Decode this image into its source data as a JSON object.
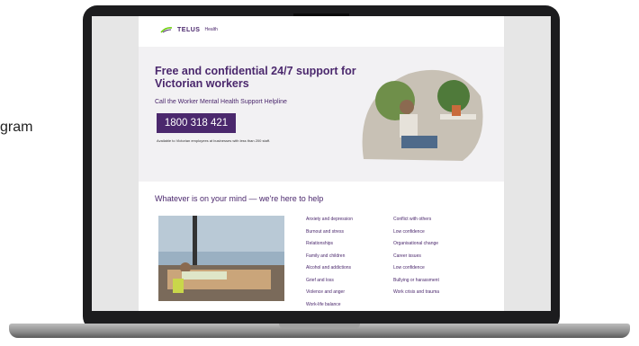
{
  "side_text": "gram",
  "brand": {
    "name": "TELUS",
    "sub": "Health"
  },
  "hero": {
    "title": "Free and confidential 24/7 support for Victorian workers",
    "subtitle": "Call the Worker Mental Health Support Helpline",
    "phone": "1800 318 421",
    "fine_print": "Available to Victorian employees at businesses with less than 200 staff."
  },
  "help": {
    "title": "Whatever is on your mind — we're here to help",
    "col1": [
      "Anxiety and depression",
      "Burnout and stress",
      "Relationships",
      "Family and children",
      "Alcohol and addictions",
      "Grief and loss",
      "Violence and anger",
      "Work-life balance"
    ],
    "col2": [
      "Conflict with others",
      "Low confidence",
      "Organisational change",
      "Career issues",
      "Low confidence",
      "Bullying or harassment",
      "Work crisis and trauma"
    ]
  },
  "colors": {
    "accent": "#4b286d",
    "brand_green": "#66cc00"
  },
  "icons": {
    "brand": "telus-logo-icon"
  }
}
